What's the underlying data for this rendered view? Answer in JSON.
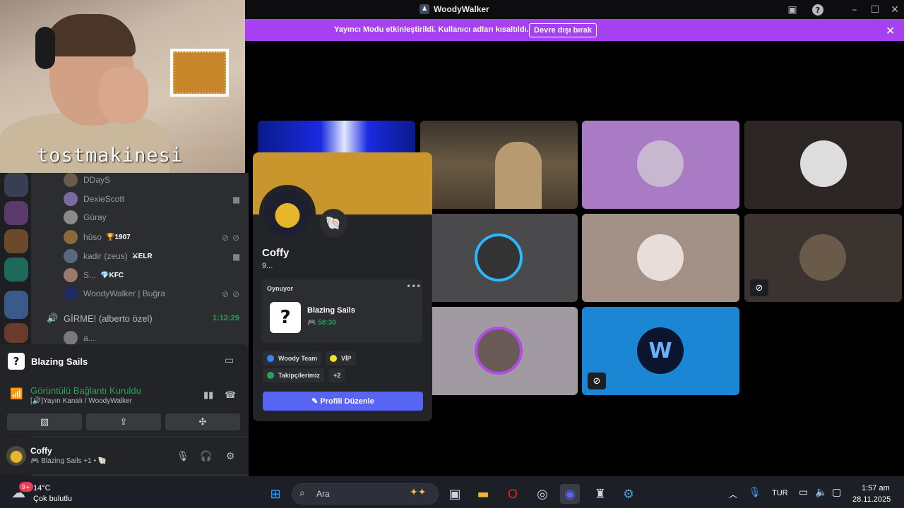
{
  "window": {
    "title": "WoodyWalker"
  },
  "banner": {
    "message": "Yayıncı Modu etkinleştirildi. Kullanıcı adları kısaltıldı.",
    "button": "Devre dışı bırak"
  },
  "webcam": {
    "label": "tostmakinesi"
  },
  "members": [
    {
      "name": "DDayS",
      "badge": ""
    },
    {
      "name": "DexieScott",
      "badge": ""
    },
    {
      "name": "Güray",
      "badge": ""
    },
    {
      "name": "hûso",
      "badge": "🏆1907"
    },
    {
      "name": "kadir (zeus)",
      "badge": "⚔ELR"
    },
    {
      "name": "S...",
      "badge": "💎KFC"
    },
    {
      "name": "WoodyWalker | Buğra",
      "badge": ""
    }
  ],
  "voice_channel": {
    "name": "GİRME! (alberto özel)",
    "timer": "1:12:29",
    "member": "a..."
  },
  "activity_panel": {
    "game": "Blazing Sails"
  },
  "rtc": {
    "status": "Görüntülü Bağlantı Kuruldu",
    "channel": "[🔊]Yayın Kanalı / WoodyWalker"
  },
  "user": {
    "name": "Coffy",
    "status": "🎮 Blazing Sails +1 • 🐚"
  },
  "profile": {
    "name": "Coffy",
    "subtitle": "9...",
    "activity_header": "Oynuyor",
    "game": "Blazing Sails",
    "elapsed": "🎮 58:30",
    "roles": [
      {
        "name": "Woody Team",
        "color": "#3b82f6"
      },
      {
        "name": "VİP",
        "color": "#f7e01d"
      },
      {
        "name": "Takipçilerimiz",
        "color": "#23a55a"
      },
      {
        "name": "+2",
        "color": ""
      }
    ],
    "edit_button": "✎ Profili Düzenle"
  },
  "taskbar": {
    "weather_temp": "14°C",
    "weather_desc": "Çok bulutlu",
    "weather_badge": "9+",
    "search_placeholder": "Ara",
    "lang": "TUR",
    "time": "1:57 am",
    "date": "28.11.2025"
  },
  "colors": {
    "accent": "#5865f2",
    "banner": "#a541f0",
    "online": "#23a55a"
  }
}
